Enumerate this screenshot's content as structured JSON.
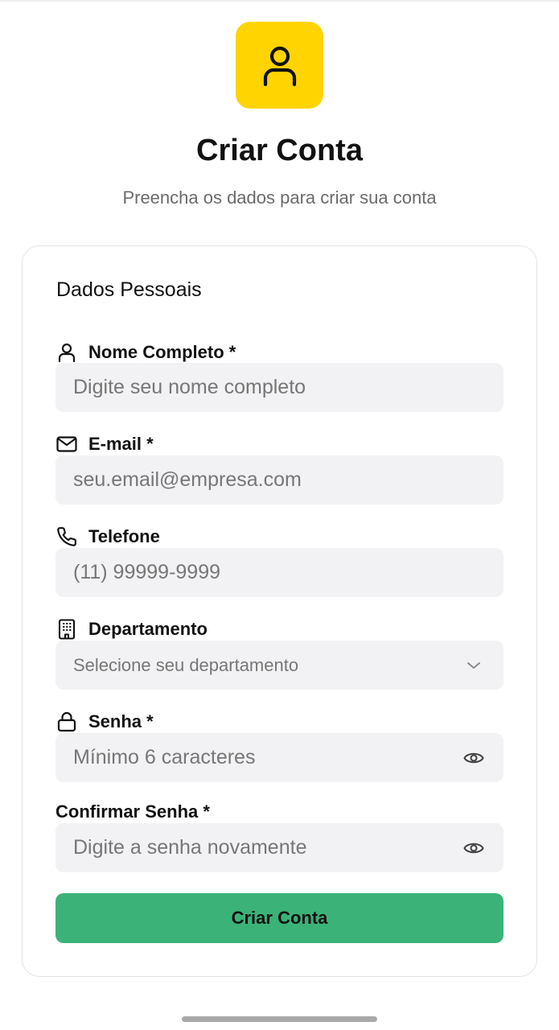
{
  "header": {
    "title": "Criar Conta",
    "subtitle": "Preencha os dados para criar sua conta",
    "logo_icon": "user-icon",
    "logo_color": "#ffd400"
  },
  "form": {
    "section_title": "Dados Pessoais",
    "fields": [
      {
        "label": "Nome Completo *",
        "icon": "user-icon",
        "placeholder": "Digite seu nome completo"
      },
      {
        "label": "E-mail *",
        "icon": "mail-icon",
        "placeholder": "seu.email@empresa.com"
      },
      {
        "label": "Telefone",
        "icon": "phone-icon",
        "placeholder": "(11) 99999-9999"
      },
      {
        "label": "Departamento",
        "icon": "building-icon",
        "placeholder": "Selecione seu departamento"
      },
      {
        "label": "Senha *",
        "icon": "lock-icon",
        "placeholder": "Mínimo 6 caracteres"
      },
      {
        "label": "Confirmar Senha *",
        "icon": "",
        "placeholder": "Digite a senha novamente"
      }
    ],
    "submit_label": "Criar Conta",
    "submit_color": "#3bb378"
  }
}
